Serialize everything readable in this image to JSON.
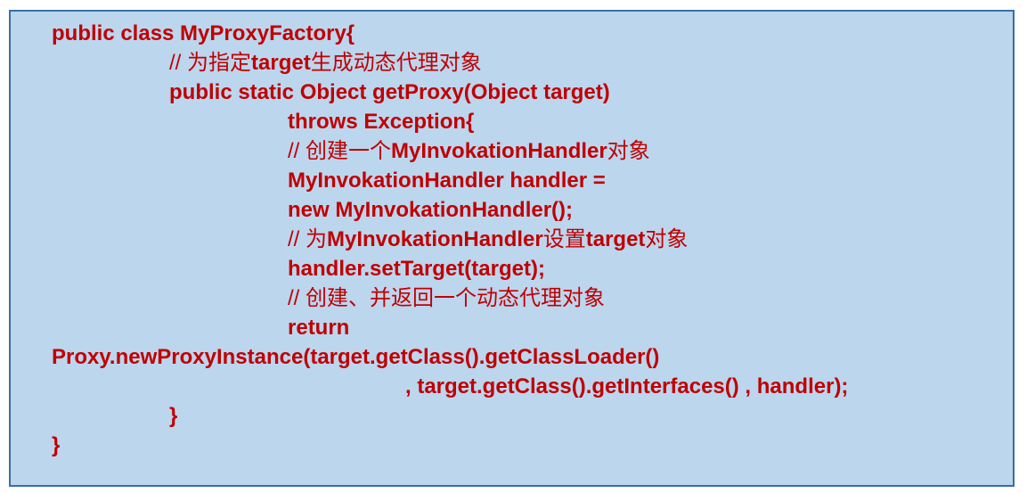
{
  "code": {
    "lines": [
      "public class MyProxyFactory{",
      "// 为指定target生成动态代理对象",
      "public static Object getProxy(Object target)",
      "throws Exception{",
      "// 创建一个MyInvokationHandler对象",
      "MyInvokationHandler handler =",
      "new MyInvokationHandler();",
      "// 为MyInvokationHandler设置target对象",
      "handler.setTarget(target);",
      "// 创建、并返回一个动态代理对象",
      "return",
      "Proxy.newProxyInstance(target.getClass().getClassLoader()",
      ", target.getClass().getInterfaces() , handler);",
      "}",
      "}"
    ]
  },
  "colors": {
    "panel_background": "#bcd6ee",
    "panel_border": "#3a6fa6",
    "code_text": "#c00000"
  }
}
